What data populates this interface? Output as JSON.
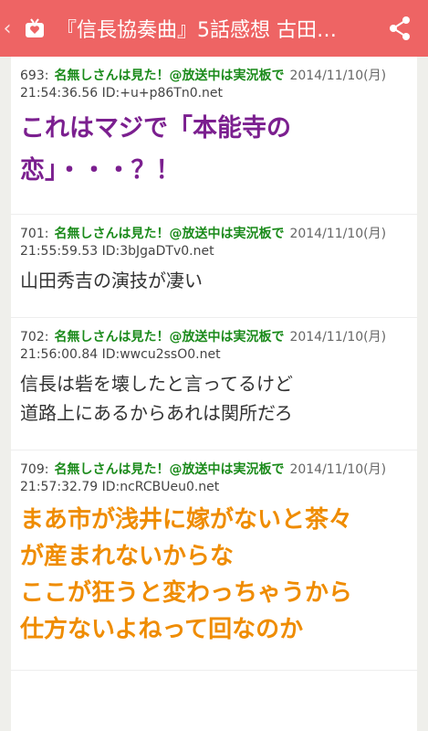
{
  "app": {
    "title": "『信長協奏曲』5話感想 古田…",
    "back_glyph": "‹"
  },
  "posts": [
    {
      "num": "693:",
      "name": "名無しさんは見た！@放送中は実況板で",
      "date": "2014/11/10(月)",
      "time": "21:54:36.56",
      "id": "ID:+u+p86Tn0.net",
      "lines": [
        "これはマジで「本能寺の",
        "恋」・・・？！"
      ]
    },
    {
      "num": "701:",
      "name": "名無しさんは見た！@放送中は実況板で",
      "date": "2014/11/10(月)",
      "time": "21:55:59.53",
      "id": "ID:3bJgaDTv0.net",
      "lines": [
        "山田秀吉の演技が凄い"
      ]
    },
    {
      "num": "702:",
      "name": "名無しさんは見た！@放送中は実況板で",
      "date": "2014/11/10(月)",
      "time": "21:56:00.84",
      "id": "ID:wwcu2ssO0.net",
      "lines": [
        "信長は砦を壊したと言ってるけど",
        "道路上にあるからあれは関所だろ"
      ]
    },
    {
      "num": "709:",
      "name": "名無しさんは見た！@放送中は実況板で",
      "date": "2014/11/10(月)",
      "time": "21:57:32.79",
      "id": "ID:ncRCBUeu0.net",
      "lines": [
        "まあ市が浅井に嫁がないと茶々",
        "が産まれないからな",
        "ここが狂うと変わっちゃうから",
        "仕方ないよねって回なのか"
      ]
    }
  ]
}
